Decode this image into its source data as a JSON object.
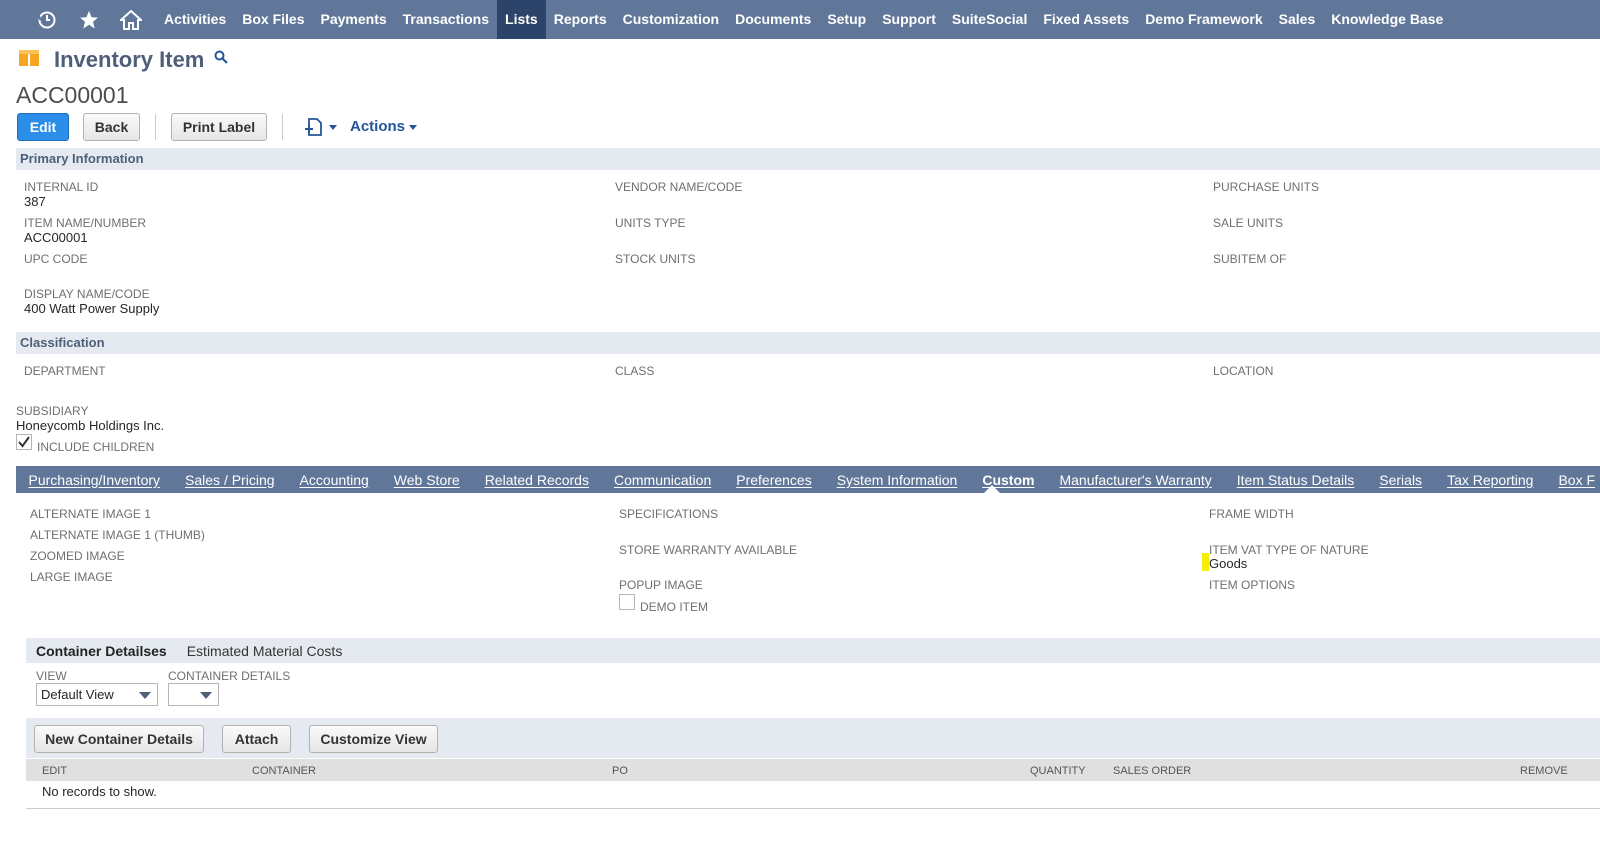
{
  "nav": {
    "icons": [
      "recent-icon",
      "star-icon",
      "home-icon"
    ],
    "items": [
      "Activities",
      "Box Files",
      "Payments",
      "Transactions",
      "Lists",
      "Reports",
      "Customization",
      "Documents",
      "Setup",
      "Support",
      "SuiteSocial",
      "Fixed Assets",
      "Demo Framework",
      "Sales",
      "Knowledge Base"
    ],
    "active": "Lists"
  },
  "header": {
    "title": "Inventory Item",
    "record_id": "ACC00001"
  },
  "toolbar": {
    "edit": "Edit",
    "back": "Back",
    "print_label": "Print Label",
    "actions": "Actions"
  },
  "primary": {
    "section": "Primary Information",
    "internal_id_label": "INTERNAL ID",
    "internal_id": "387",
    "item_name_label": "ITEM NAME/NUMBER",
    "item_name": "ACC00001",
    "upc_label": "UPC CODE",
    "display_name_label": "DISPLAY NAME/CODE",
    "display_name": "400 Watt Power Supply",
    "vendor_label": "VENDOR NAME/CODE",
    "units_type_label": "UNITS TYPE",
    "stock_units_label": "STOCK UNITS",
    "purchase_units_label": "PURCHASE UNITS",
    "sale_units_label": "SALE UNITS",
    "subitem_label": "SUBITEM OF"
  },
  "classification": {
    "section": "Classification",
    "department_label": "DEPARTMENT",
    "class_label": "CLASS",
    "location_label": "LOCATION",
    "subsidiary_label": "SUBSIDIARY",
    "subsidiary": "Honeycomb Holdings Inc.",
    "include_children": "INCLUDE CHILDREN"
  },
  "subtabs": {
    "items": [
      "Purchasing/Inventory",
      "Sales / Pricing",
      "Accounting",
      "Web Store",
      "Related Records",
      "Communication",
      "Preferences",
      "System Information",
      "Custom",
      "Manufacturer's Warranty",
      "Item Status Details",
      "Serials",
      "Tax Reporting",
      "Box F"
    ],
    "active": "Custom"
  },
  "custom": {
    "alt_image": "ALTERNATE IMAGE 1",
    "alt_image_thumb": "ALTERNATE IMAGE 1 (THUMB)",
    "zoomed_image": "ZOOMED IMAGE",
    "large_image": "LARGE IMAGE",
    "specifications": "SPECIFICATIONS",
    "store_warranty": "STORE WARRANTY AVAILABLE",
    "popup_image": "POPUP IMAGE",
    "demo_item": "DEMO ITEM",
    "frame_width": "FRAME WIDTH",
    "vat_type_label": "ITEM VAT TYPE OF NATURE",
    "vat_type": "Goods",
    "item_options": "ITEM OPTIONS"
  },
  "sublist": {
    "tabs": [
      "Container Detailses",
      "Estimated Material Costs"
    ],
    "view_label": "VIEW",
    "view_value": "Default View",
    "container_label": "CONTAINER DETAILS",
    "container_value": "",
    "buttons": [
      "New Container Details",
      "Attach",
      "Customize View"
    ],
    "columns": [
      "EDIT",
      "CONTAINER",
      "PO",
      "QUANTITY",
      "SALES ORDER",
      "REMOVE"
    ],
    "empty": "No records to show."
  },
  "colors": {
    "nav": "#607799",
    "nav_active": "#2c4469",
    "primary_btn": "#2c8ee8",
    "section": "#e5eaf1",
    "highlight": "#f5f000"
  }
}
